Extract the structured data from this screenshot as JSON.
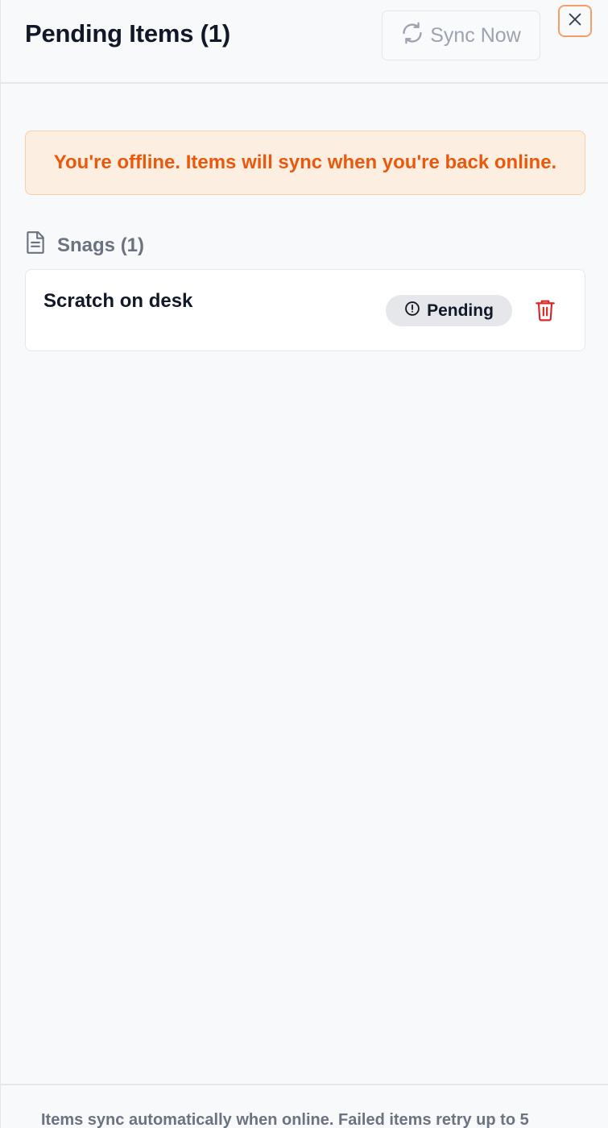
{
  "header": {
    "title": "Pending Items (1)",
    "sync_label": "Sync Now",
    "sync_icon": "refresh-icon",
    "close_icon": "close-icon"
  },
  "banner": {
    "message": "You're offline. Items will sync when you're back online.",
    "color": "#ea580c"
  },
  "section": {
    "icon": "document-icon",
    "label": "Snags (1)"
  },
  "items": [
    {
      "title": "Scratch on desk",
      "status": "Pending",
      "status_icon": "alert-circle-icon",
      "delete_icon": "trash-icon"
    }
  ],
  "footer": {
    "text": "Items sync automatically when online. Failed items retry up to 5"
  },
  "colors": {
    "accent_orange": "#f59e6a",
    "danger": "#dc2626",
    "muted": "#6b7280"
  }
}
